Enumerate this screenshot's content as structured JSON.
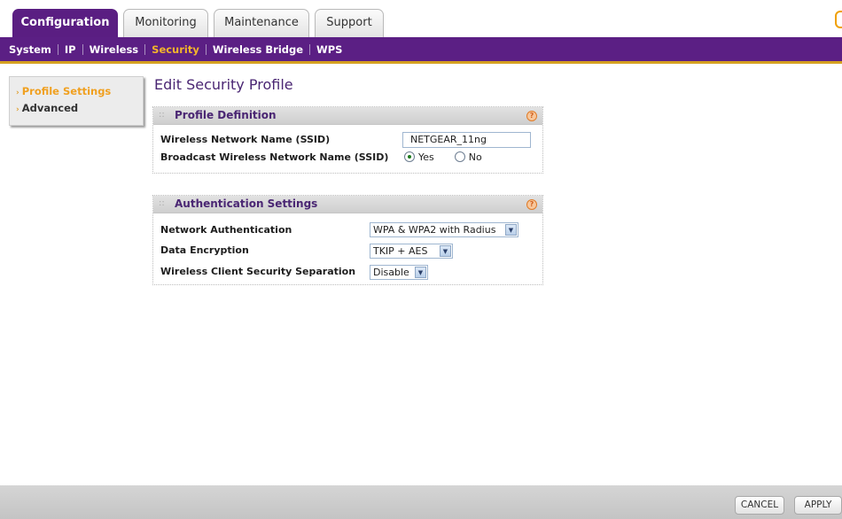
{
  "tabs": [
    {
      "label": "Configuration",
      "active": true
    },
    {
      "label": "Monitoring",
      "active": false
    },
    {
      "label": "Maintenance",
      "active": false
    },
    {
      "label": "Support",
      "active": false
    }
  ],
  "subnav": {
    "items": [
      "System",
      "IP",
      "Wireless",
      "Security",
      "Wireless Bridge",
      "WPS"
    ],
    "active": "Security"
  },
  "sidebar": {
    "items": [
      {
        "label": "Profile Settings",
        "active": true
      },
      {
        "label": "Advanced",
        "active": false
      }
    ]
  },
  "page": {
    "title": "Edit Security Profile"
  },
  "profile_definition": {
    "title": "Profile Definition",
    "ssid_label": "Wireless Network Name (SSID)",
    "ssid_value": "NETGEAR_11ng",
    "broadcast_label": "Broadcast Wireless Network Name (SSID)",
    "broadcast_yes": "Yes",
    "broadcast_no": "No",
    "broadcast_selected": "Yes"
  },
  "authentication_settings": {
    "title": "Authentication Settings",
    "network_auth_label": "Network Authentication",
    "network_auth_value": "WPA & WPA2 with Radius",
    "data_encryption_label": "Data Encryption",
    "data_encryption_value": "TKIP + AES",
    "client_separation_label": "Wireless Client Security Separation",
    "client_separation_value": "Disable"
  },
  "footer": {
    "cancel_label": "CANCEL",
    "apply_label": "APPLY"
  },
  "colors": {
    "brand_purple": "#5b1f84",
    "accent_orange": "#f3b52b",
    "section_title": "#4a2673"
  },
  "icons": {
    "help": "help-icon",
    "dropdown": "chevron-down-icon"
  }
}
